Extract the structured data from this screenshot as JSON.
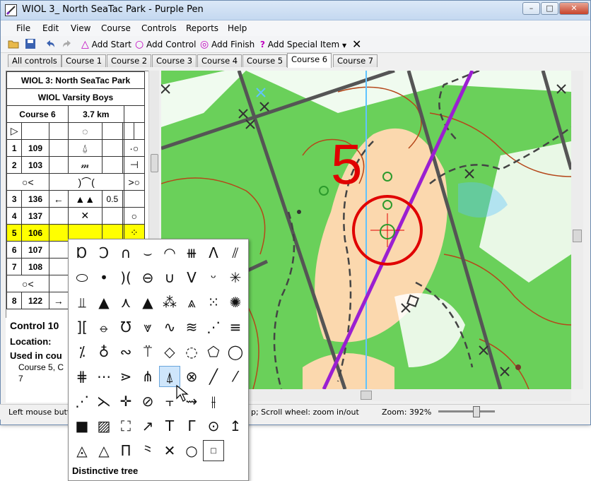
{
  "window": {
    "title": "WIOL 3_ North SeaTac Park - Purple Pen"
  },
  "menu": [
    "File",
    "Edit",
    "View",
    "Course",
    "Controls",
    "Reports",
    "Help"
  ],
  "toolbar": {
    "add_start": "Add Start",
    "add_control": "Add Control",
    "add_finish": "Add Finish",
    "add_special": "Add Special Item"
  },
  "tabs": [
    "All controls",
    "Course 1",
    "Course 2",
    "Course 3",
    "Course 4",
    "Course 5",
    "Course 6",
    "Course 7"
  ],
  "active_tab": "Course 6",
  "description": {
    "title": "WIOL 3: North SeaTac Park",
    "subtitle": "WIOL Varsity Boys",
    "course": "Course 6",
    "length": "3.7 km",
    "rows": [
      {
        "num": "1",
        "code": "109",
        "c3": "",
        "c4": "⍙",
        "c5": "",
        "c6": "",
        "c7": "·○"
      },
      {
        "num": "2",
        "code": "103",
        "c3": "",
        "c4": "𝓂",
        "c5": "",
        "c6": "",
        "c7": "⊣"
      },
      {
        "num": "3",
        "code": "136",
        "c3": "←",
        "c4": "▲▲",
        "c5": "0.5",
        "c6": "",
        "c7": ""
      },
      {
        "num": "4",
        "code": "137",
        "c3": "",
        "c4": "✕",
        "c5": "",
        "c6": "",
        "c7": "○"
      },
      {
        "num": "5",
        "code": "106",
        "c3": "",
        "c4": "",
        "c5": "",
        "c6": "",
        "c7": "⁘"
      },
      {
        "num": "6",
        "code": "107",
        "c3": "",
        "c4": "",
        "c5": "",
        "c6": "",
        "c7": ""
      },
      {
        "num": "7",
        "code": "108",
        "c3": "",
        "c4": "",
        "c5": "",
        "c6": "",
        "c7": ""
      },
      {
        "num": "8",
        "code": "122",
        "c3": "→",
        "c4": "",
        "c5": "",
        "c6": "",
        "c7": ""
      }
    ]
  },
  "properties": {
    "control": "Control 10",
    "location_label": "Location:",
    "used_label": "Used in cou",
    "used_value": "Course 5, C",
    "extra": "7"
  },
  "map": {
    "control_number": "5"
  },
  "status": {
    "left": "Left mouse butt",
    "middle": "p;  Scroll wheel: zoom in/out",
    "zoom": "Zoom: 392%"
  },
  "symbol_popup": {
    "symbols": [
      "Ɒ",
      "Ͻ",
      "∩",
      "⌣",
      "◠",
      "⧻",
      "Λ",
      "⫽",
      "⬭",
      "•",
      ")(",
      "⊖",
      "∪",
      "V",
      "ᵕ",
      "✳",
      "⫫",
      "▲",
      "⋏",
      "▲",
      "⁂",
      "⩓",
      "⁙",
      "✺",
      "][",
      "⦵",
      "Ʊ",
      "⩔",
      "∿",
      "≋",
      "⋰",
      "≡",
      "⁒",
      "♁",
      "∾",
      "⍡",
      "◇",
      "◌",
      "⬠",
      "◯",
      "⋕",
      "⋯",
      "⋗",
      "⋔",
      "⍋",
      "⊗",
      "╱",
      "⁄",
      "⋰",
      "⋋",
      "✛",
      "⊘",
      "⫟",
      "⇝",
      "⫲",
      "",
      "■",
      "▨",
      "⛶",
      "↗",
      "T",
      "Γ",
      "⊙",
      "↥",
      "◬",
      "△",
      "Π",
      "⺀",
      "✕",
      "○",
      "□",
      ""
    ],
    "selected_index": 44,
    "caption": "Distinctive tree"
  }
}
